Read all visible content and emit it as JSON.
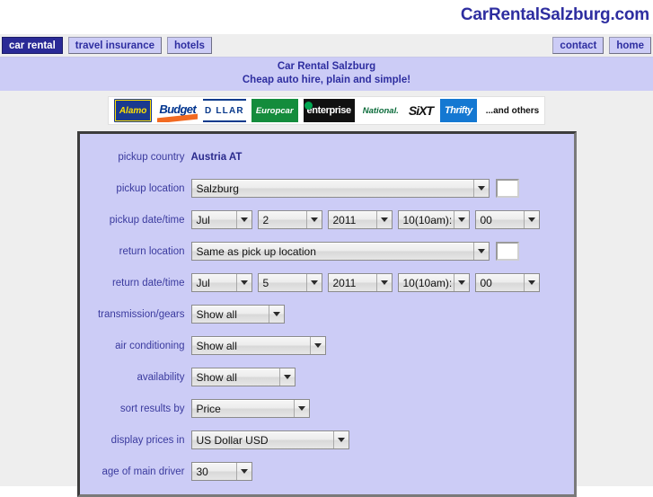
{
  "header": {
    "site_title": "CarRentalSalzburg.com"
  },
  "nav": {
    "left_items": [
      {
        "label": "car rental",
        "active": true
      },
      {
        "label": "travel insurance",
        "active": false
      },
      {
        "label": "hotels",
        "active": false
      }
    ],
    "right_items": [
      {
        "label": "contact"
      },
      {
        "label": "home"
      }
    ]
  },
  "tagline": {
    "line1": "Car Rental Salzburg",
    "line2": "Cheap auto hire, plain and simple!"
  },
  "logos": [
    {
      "name": "alamo-logo",
      "text": "Alamo"
    },
    {
      "name": "budget-logo",
      "text": "Budget"
    },
    {
      "name": "dollar-logo",
      "text": "D LLAR"
    },
    {
      "name": "europcar-logo",
      "text": "Europcar"
    },
    {
      "name": "enterprise-logo",
      "text": "enterprise"
    },
    {
      "name": "national-logo",
      "text": "National."
    },
    {
      "name": "sixt-logo",
      "text": "SiXT"
    },
    {
      "name": "thrifty-logo",
      "text": "Thrifty"
    },
    {
      "name": "and-others-label",
      "text": "...and others"
    }
  ],
  "form": {
    "pickup_country": {
      "label": "pickup country",
      "value": "Austria AT"
    },
    "pickup_location": {
      "label": "pickup location",
      "value": "Salzburg",
      "extra_value": ""
    },
    "pickup_datetime": {
      "label": "pickup date/time",
      "month": "Jul",
      "day": "2",
      "year": "2011",
      "hour": "10(10am):",
      "minute": "00"
    },
    "return_location": {
      "label": "return location",
      "value": "Same as pick up location",
      "extra_value": ""
    },
    "return_datetime": {
      "label": "return date/time",
      "month": "Jul",
      "day": "5",
      "year": "2011",
      "hour": "10(10am):",
      "minute": "00"
    },
    "transmission": {
      "label": "transmission/gears",
      "value": "Show all"
    },
    "air_conditioning": {
      "label": "air conditioning",
      "value": "Show all"
    },
    "availability": {
      "label": "availability",
      "value": "Show all"
    },
    "sort_results": {
      "label": "sort results by",
      "value": "Price"
    },
    "display_prices": {
      "label": "display prices in",
      "value": "US Dollar USD"
    },
    "driver_age": {
      "label": "age of main driver",
      "value": "30"
    }
  },
  "colors": {
    "brand_purple": "#2e2ea0",
    "panel_lavender": "#ccccf6",
    "page_gray": "#eeeeee",
    "nav_active_bg": "#2a2a96"
  }
}
